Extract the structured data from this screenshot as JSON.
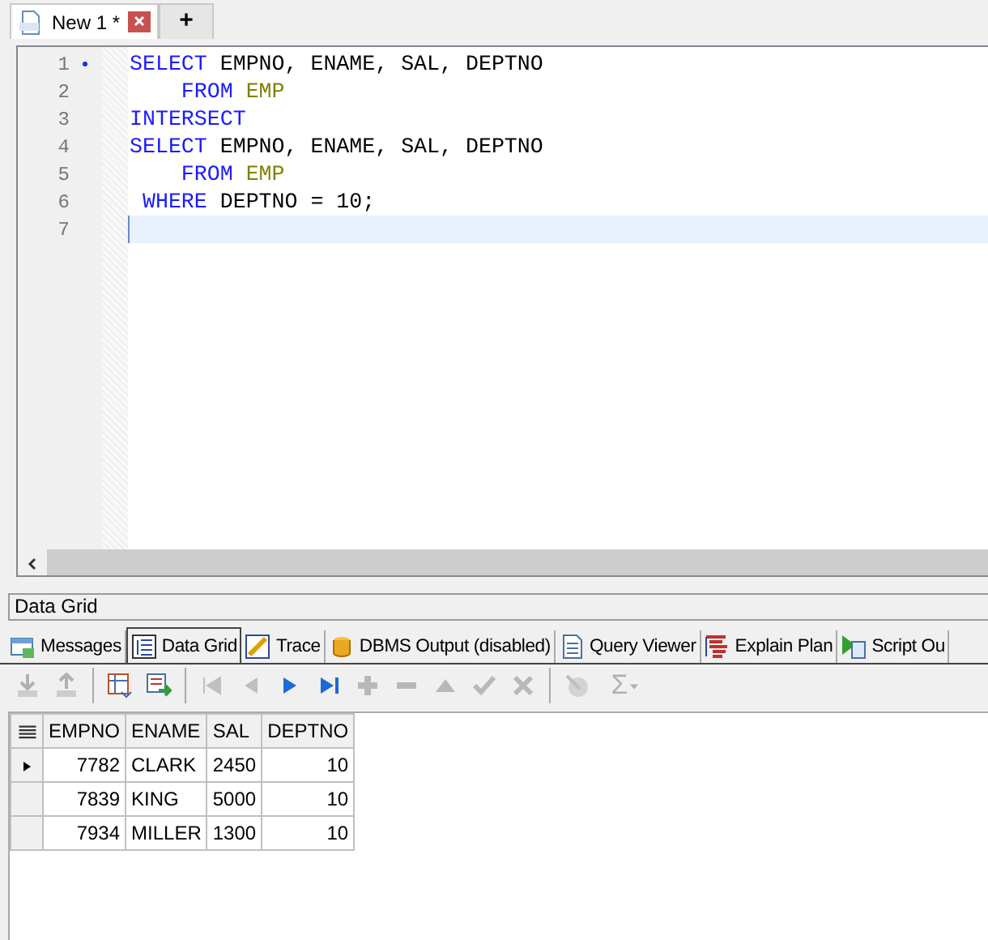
{
  "editor_tabs": [
    {
      "label": "New 1 *",
      "selected": true
    },
    {
      "label": "+",
      "selected": false
    }
  ],
  "editor": {
    "lines": [
      {
        "number": "1",
        "changed": true,
        "current": false,
        "tokens": [
          {
            "text": "SELECT",
            "kind": "keyword"
          },
          {
            "text": " EMPNO, ENAME, SAL, DEPTNO",
            "kind": "plain"
          }
        ]
      },
      {
        "number": "2",
        "changed": false,
        "current": false,
        "tokens": [
          {
            "text": "    FROM",
            "kind": "keyword"
          },
          {
            "text": " EMP",
            "kind": "table"
          }
        ]
      },
      {
        "number": "3",
        "changed": false,
        "current": false,
        "tokens": [
          {
            "text": "INTERSECT",
            "kind": "keyword"
          }
        ]
      },
      {
        "number": "4",
        "changed": false,
        "current": false,
        "tokens": [
          {
            "text": "SELECT",
            "kind": "keyword"
          },
          {
            "text": " EMPNO, ENAME, SAL, DEPTNO",
            "kind": "plain"
          }
        ]
      },
      {
        "number": "5",
        "changed": false,
        "current": false,
        "tokens": [
          {
            "text": "    FROM",
            "kind": "keyword"
          },
          {
            "text": " EMP",
            "kind": "table"
          }
        ]
      },
      {
        "number": "6",
        "changed": false,
        "current": false,
        "tokens": [
          {
            "text": " WHERE",
            "kind": "keyword"
          },
          {
            "text": " DEPTNO = 10;",
            "kind": "plain"
          }
        ]
      },
      {
        "number": "7",
        "changed": false,
        "current": true
      }
    ]
  },
  "panel_title": "Data Grid",
  "result_tabs": [
    {
      "label": "Messages",
      "selected": false
    },
    {
      "label": "Data Grid",
      "selected": true
    },
    {
      "label": "Trace",
      "selected": false
    },
    {
      "label": "DBMS Output (disabled)",
      "selected": false
    },
    {
      "label": "Query Viewer",
      "selected": false
    },
    {
      "label": "Explain Plan",
      "selected": false
    },
    {
      "label": "Script Ou",
      "selected": false
    }
  ],
  "toolbar": [
    {
      "kind": "button",
      "disabled": true
    },
    {
      "kind": "button",
      "disabled": true
    },
    {
      "kind": "separator"
    },
    {
      "kind": "button",
      "disabled": false
    },
    {
      "kind": "button",
      "disabled": false
    },
    {
      "kind": "separator"
    },
    {
      "kind": "button",
      "disabled": true
    },
    {
      "kind": "button",
      "disabled": true
    },
    {
      "kind": "button",
      "disabled": false
    },
    {
      "kind": "button",
      "disabled": false
    },
    {
      "kind": "button",
      "disabled": true
    },
    {
      "kind": "button",
      "disabled": true
    },
    {
      "kind": "button",
      "disabled": true
    },
    {
      "kind": "button",
      "disabled": true
    },
    {
      "kind": "button",
      "disabled": true
    },
    {
      "kind": "separator"
    },
    {
      "kind": "button",
      "disabled": true
    },
    {
      "kind": "sum",
      "label": "Σ",
      "disabled": true
    }
  ],
  "table": {
    "columns": [
      {
        "label": "EMPNO"
      },
      {
        "label": "ENAME"
      },
      {
        "label": "SAL"
      },
      {
        "label": "DEPTNO"
      }
    ],
    "rows": [
      {
        "selected": true,
        "cells": [
          "7782",
          "CLARK",
          "2450",
          "10"
        ]
      },
      {
        "selected": false,
        "cells": [
          "7839",
          "KING",
          "5000",
          "10"
        ]
      },
      {
        "selected": false,
        "cells": [
          "7934",
          "MILLER",
          "1300",
          "10"
        ]
      }
    ]
  }
}
